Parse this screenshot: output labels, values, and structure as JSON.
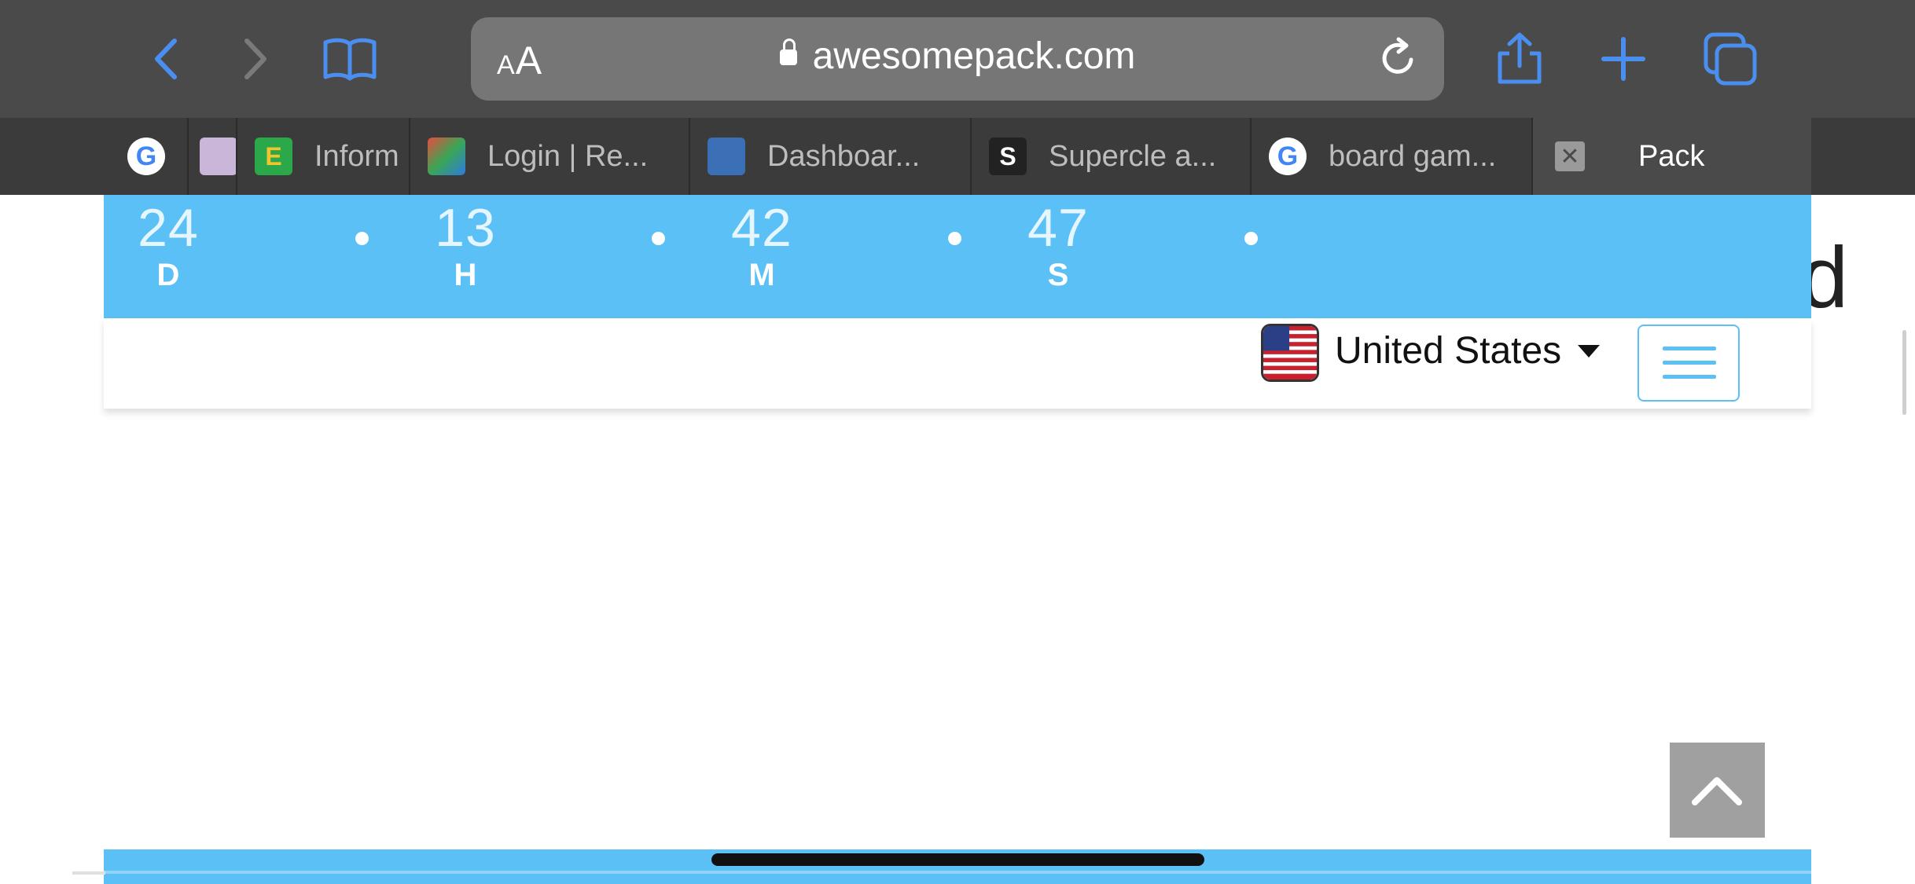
{
  "browser": {
    "text_size_label": "AA",
    "url": "awesomepack.com",
    "accent": "#4a8ff0"
  },
  "tabs": [
    {
      "title": "",
      "icon": "google-icon",
      "active": false
    },
    {
      "title": "",
      "icon": "crest-icon",
      "active": false
    },
    {
      "title": "Inform",
      "icon": "e-logo-icon",
      "active": false
    },
    {
      "title": "Login | Re...",
      "icon": "colorful-logo-icon",
      "active": false
    },
    {
      "title": "Dashboar...",
      "icon": "dashboard-logo-icon",
      "active": false
    },
    {
      "title": "Supercle a...",
      "icon": "s-logo-icon",
      "active": false
    },
    {
      "title": "board gam...",
      "icon": "google-icon",
      "active": false
    },
    {
      "title": "Pack",
      "icon": "close-icon",
      "active": true
    }
  ],
  "countdown": {
    "units": [
      {
        "value": "24",
        "label": "D"
      },
      {
        "value": "13",
        "label": "H"
      },
      {
        "value": "42",
        "label": "M"
      },
      {
        "value": "47",
        "label": "S"
      }
    ],
    "background": "#5bc0f5"
  },
  "header": {
    "country": "United States",
    "menu_icon": "hamburger-icon"
  },
  "page": {
    "edge_text": "d"
  }
}
